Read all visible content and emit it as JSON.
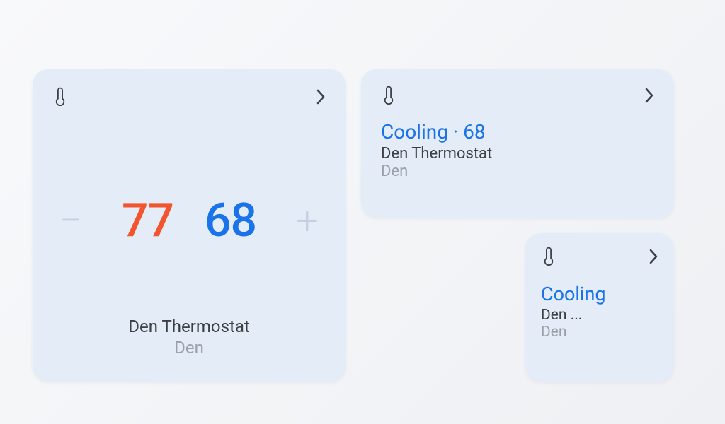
{
  "colors": {
    "card_bg": "#e4ecf8",
    "accent_cool": "#1a73e8",
    "accent_heat": "#f2542d",
    "text_primary": "#3c4043",
    "text_secondary": "#9aa0a6",
    "stepper_muted": "#c6cfe0"
  },
  "large_card": {
    "heat_temp": "77",
    "cool_temp": "68",
    "minus_glyph": "−",
    "plus_glyph": "+",
    "device_name": "Den Thermostat",
    "room": "Den"
  },
  "medium_card": {
    "status_line": "Cooling · 68",
    "device_name": "Den Thermostat",
    "room": "Den"
  },
  "small_card": {
    "status_line": "Cooling",
    "device_name": "Den ...",
    "room": "Den"
  }
}
